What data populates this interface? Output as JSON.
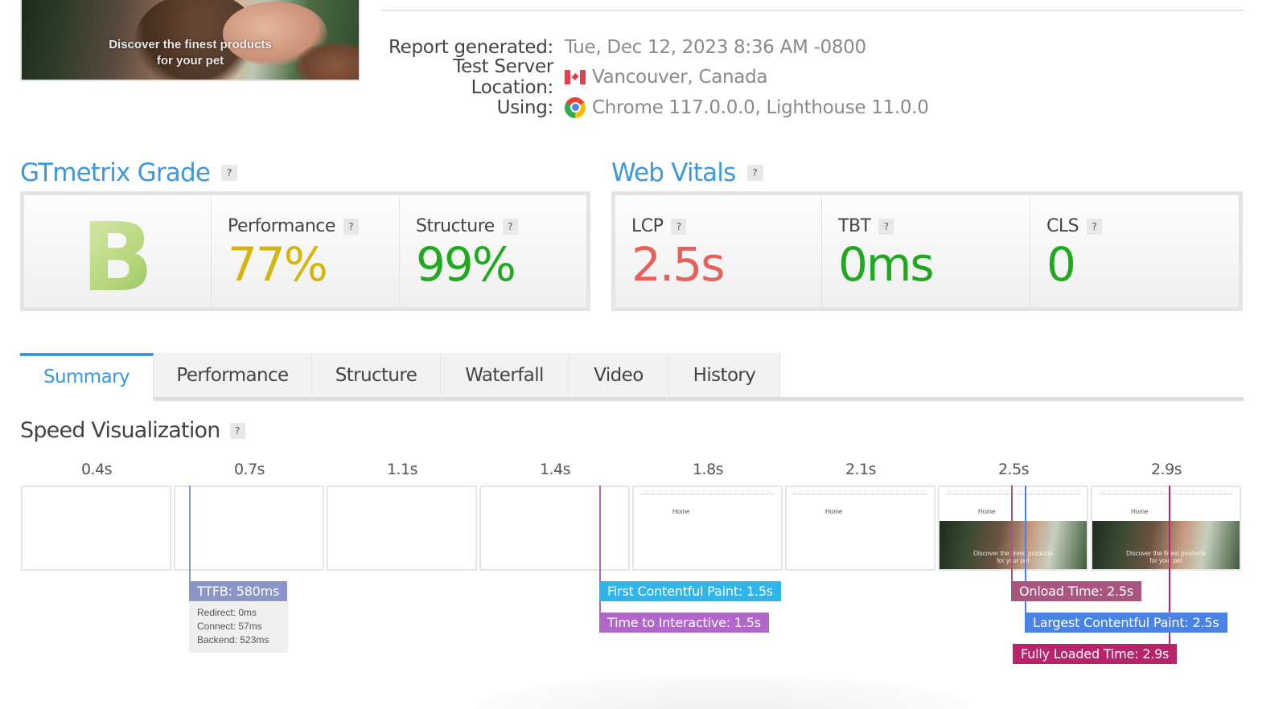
{
  "preview": {
    "caption_line1": "Discover the finest products",
    "caption_line2": "for your pet"
  },
  "report": {
    "rows": [
      {
        "label": "Report generated:",
        "value": "Tue, Dec 12, 2023 8:36 AM -0800",
        "icon": "none"
      },
      {
        "label": "Test Server Location:",
        "value": "Vancouver, Canada",
        "icon": "canada-flag-icon"
      },
      {
        "label": "Using:",
        "value": "Chrome 117.0.0.0, Lighthouse 11.0.0",
        "icon": "chrome-icon"
      }
    ]
  },
  "gtmetrix_grade": {
    "title": "GTmetrix Grade",
    "help": "?",
    "grade": "B",
    "performance": {
      "label": "Performance",
      "value": "77%",
      "color": "#d4b50e"
    },
    "structure": {
      "label": "Structure",
      "value": "99%",
      "color": "#20a81e"
    }
  },
  "web_vitals": {
    "title": "Web Vitals",
    "help": "?",
    "lcp": {
      "label": "LCP",
      "value": "2.5s",
      "color": "#e8605a"
    },
    "tbt": {
      "label": "TBT",
      "value": "0ms",
      "color": "#20a81e"
    },
    "cls": {
      "label": "CLS",
      "value": "0",
      "color": "#20a81e"
    }
  },
  "tabs": [
    {
      "label": "Summary",
      "active": true
    },
    {
      "label": "Performance",
      "active": false
    },
    {
      "label": "Structure",
      "active": false
    },
    {
      "label": "Waterfall",
      "active": false
    },
    {
      "label": "Video",
      "active": false
    },
    {
      "label": "History",
      "active": false
    }
  ],
  "speed_visualization": {
    "title": "Speed Visualization",
    "help": "?",
    "frames": [
      {
        "time": "0.4s",
        "state": "blank"
      },
      {
        "time": "0.7s",
        "state": "blank"
      },
      {
        "time": "1.1s",
        "state": "blank"
      },
      {
        "time": "1.4s",
        "state": "blank"
      },
      {
        "time": "1.8s",
        "state": "header"
      },
      {
        "time": "2.1s",
        "state": "header"
      },
      {
        "time": "2.5s",
        "state": "full"
      },
      {
        "time": "2.9s",
        "state": "full"
      }
    ],
    "frame_home_text": "Home",
    "frame_hero_caption_1": "Discover the finest products",
    "frame_hero_caption_2": "for your pet",
    "ttfb": {
      "label": "TTFB: 580ms",
      "color": "#8c95c8",
      "details": [
        "Redirect: 0ms",
        "Connect: 57ms",
        "Backend: 523ms"
      ]
    },
    "markers": {
      "fcp": {
        "label": "First Contentful Paint: 1.5s",
        "color": "#2eb5ea"
      },
      "tti": {
        "label": "Time to Interactive: 1.5s",
        "color": "#b067c9"
      },
      "onload": {
        "label": "Onload Time: 2.5s",
        "color": "#a9557e"
      },
      "lcp": {
        "label": "Largest Contentful Paint: 2.5s",
        "color": "#4a82e6"
      },
      "fully_loaded": {
        "label": "Fully Loaded Time: 2.9s",
        "color": "#b8236a"
      }
    }
  }
}
